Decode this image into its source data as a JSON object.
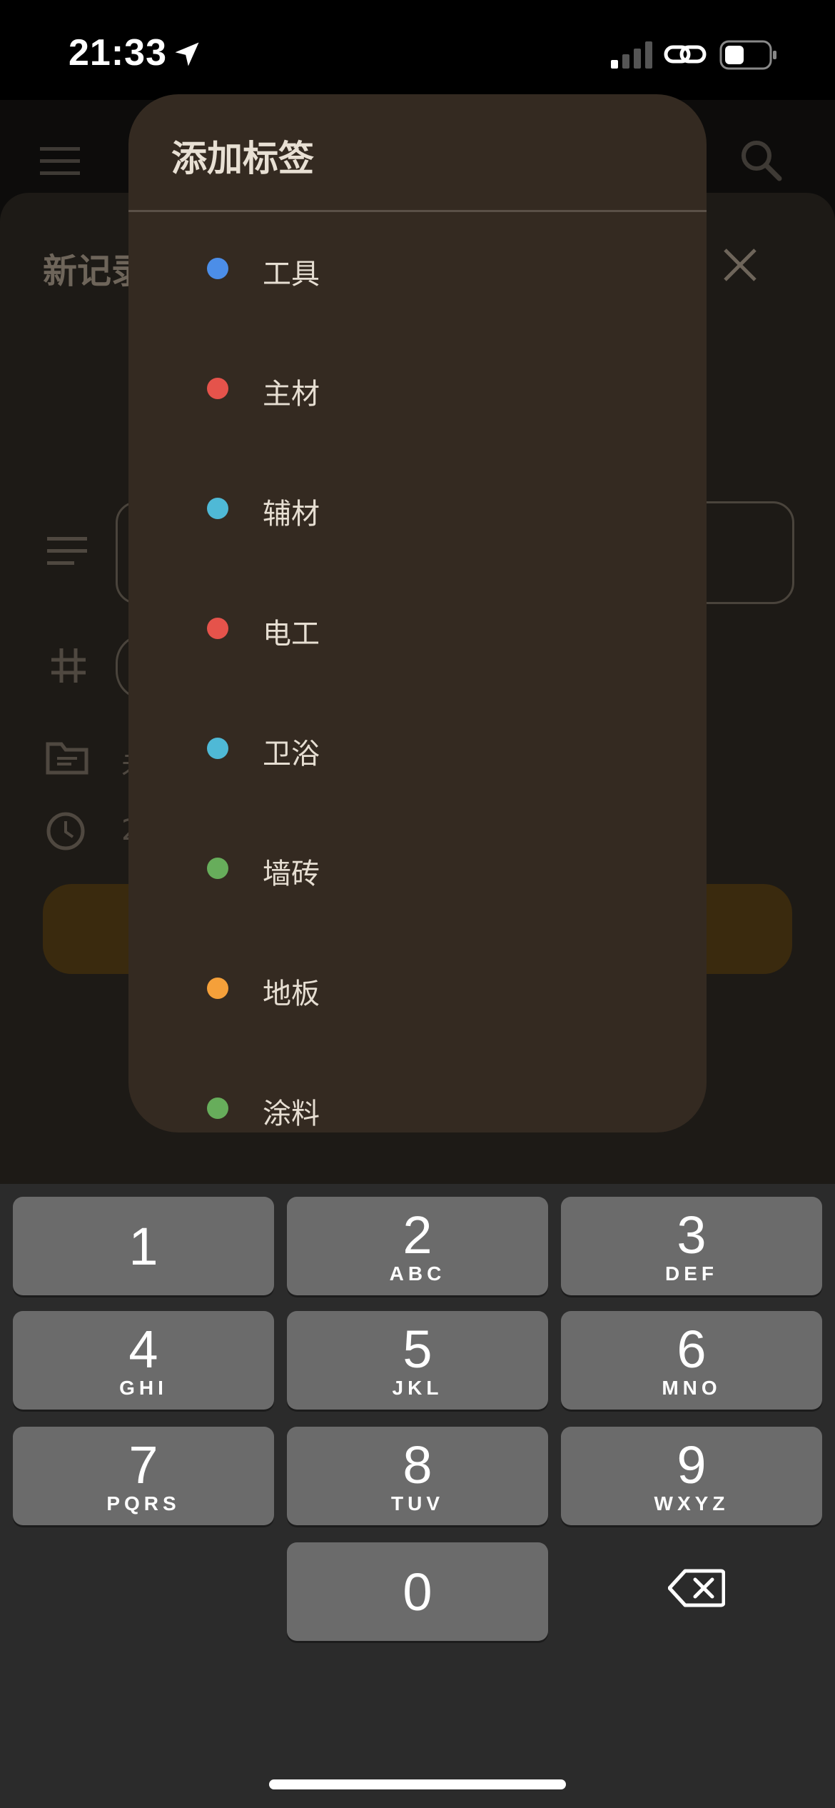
{
  "status_bar": {
    "time": "21:33"
  },
  "background": {
    "title": "新记录",
    "row_values": {
      "folder": "未",
      "time": "2"
    }
  },
  "dialog": {
    "title": "添加标签",
    "tags": [
      {
        "label": "工具",
        "color": "#4c8ee8"
      },
      {
        "label": "主材",
        "color": "#e5534b"
      },
      {
        "label": "辅材",
        "color": "#4fb9d6"
      },
      {
        "label": "电工",
        "color": "#e5534b"
      },
      {
        "label": "卫浴",
        "color": "#4fb9d6"
      },
      {
        "label": "墙砖",
        "color": "#67ad5b"
      },
      {
        "label": "地板",
        "color": "#f5a03a"
      },
      {
        "label": "涂料",
        "color": "#67ad5b"
      }
    ]
  },
  "keyboard": {
    "keys": [
      {
        "num": "1",
        "letters": ""
      },
      {
        "num": "2",
        "letters": "ABC"
      },
      {
        "num": "3",
        "letters": "DEF"
      },
      {
        "num": "4",
        "letters": "GHI"
      },
      {
        "num": "5",
        "letters": "JKL"
      },
      {
        "num": "6",
        "letters": "MNO"
      },
      {
        "num": "7",
        "letters": "PQRS"
      },
      {
        "num": "8",
        "letters": "TUV"
      },
      {
        "num": "9",
        "letters": "WXYZ"
      },
      {
        "num": "0",
        "letters": ""
      }
    ]
  }
}
